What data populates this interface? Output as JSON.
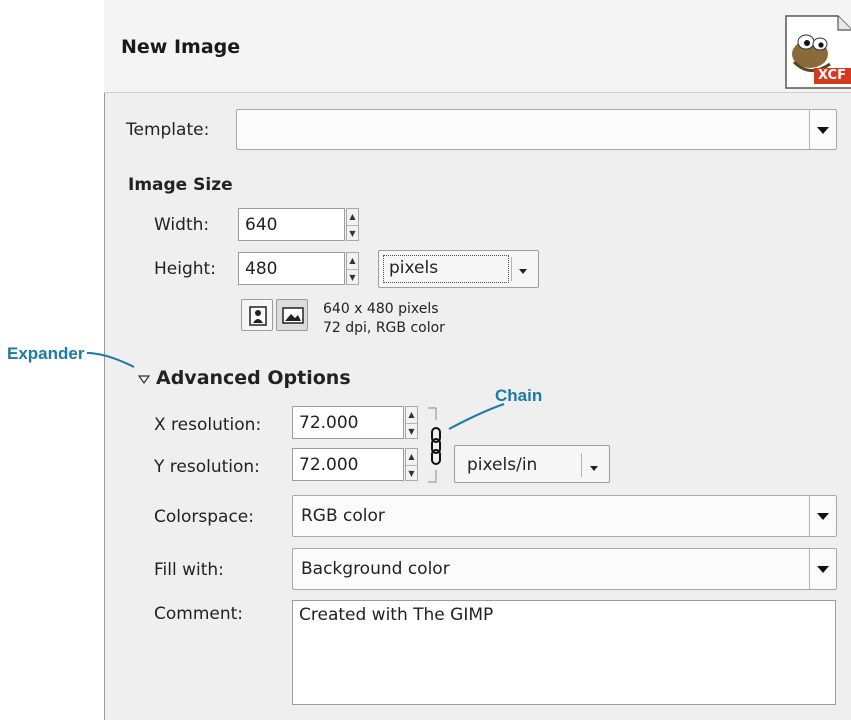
{
  "dialog": {
    "title": "New Image",
    "icon": "gimp-wilber-xcf-icon",
    "logo_badge": "XCF"
  },
  "template": {
    "label": "Template:",
    "value": ""
  },
  "image_size": {
    "section": "Image Size",
    "width_label": "Width:",
    "width_value": "640",
    "height_label": "Height:",
    "height_value": "480",
    "unit": "pixels",
    "info_line1": "640 x 480 pixels",
    "info_line2": "72 dpi, RGB color"
  },
  "advanced": {
    "label": "Advanced Options",
    "expanded": true,
    "x_res_label": "X resolution:",
    "x_res_value": "72.000",
    "y_res_label": "Y resolution:",
    "y_res_value": "72.000",
    "res_unit": "pixels/in",
    "colorspace_label": "Colorspace:",
    "colorspace_value": "RGB color",
    "fill_label": "Fill with:",
    "fill_value": "Background color",
    "comment_label": "Comment:",
    "comment_value": "Created with The GIMP"
  },
  "annotations": {
    "expander": "Expander",
    "chain": "Chain",
    "color": "#1b7aa6"
  }
}
